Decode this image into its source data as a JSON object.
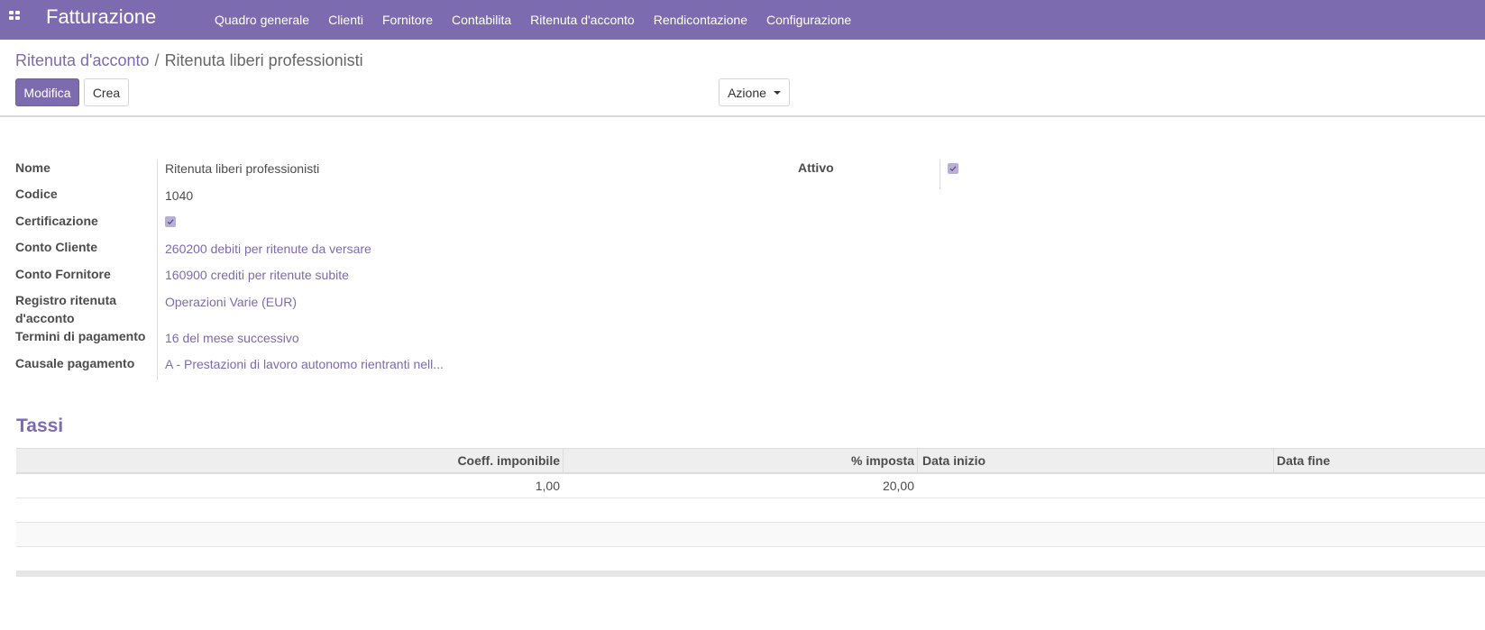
{
  "app": {
    "title": "Fatturazione"
  },
  "menu": [
    "Quadro generale",
    "Clienti",
    "Fornitore",
    "Contabilita",
    "Ritenuta d'acconto",
    "Rendicontazione",
    "Configurazione"
  ],
  "breadcrumb": {
    "parent": "Ritenuta d'acconto",
    "separator": "/",
    "current": "Ritenuta liberi professionisti"
  },
  "buttons": {
    "edit": "Modifica",
    "create": "Crea",
    "action": "Azione"
  },
  "form": {
    "nome": {
      "label": "Nome",
      "value": "Ritenuta liberi professionisti"
    },
    "codice": {
      "label": "Codice",
      "value": "1040"
    },
    "certificazione": {
      "label": "Certificazione",
      "checked": true
    },
    "conto_cliente": {
      "label": "Conto Cliente",
      "value": "260200 debiti per ritenute da versare"
    },
    "conto_fornitore": {
      "label": "Conto Fornitore",
      "value": "160900 crediti per ritenute subite"
    },
    "registro": {
      "label": "Registro ritenuta d'acconto",
      "value": "Operazioni Varie (EUR)"
    },
    "termini": {
      "label": "Termini di pagamento",
      "value": "16 del mese successivo"
    },
    "causale": {
      "label": "Causale pagamento",
      "value": "A - Prestazioni di lavoro autonomo rientranti nell..."
    },
    "attivo": {
      "label": "Attivo",
      "checked": true
    }
  },
  "tassi": {
    "title": "Tassi",
    "columns": [
      "Coeff. imponibile",
      "% imposta",
      "Data inizio",
      "Data fine"
    ],
    "rows": [
      {
        "coeff": "1,00",
        "imposta": "20,00",
        "data_inizio": "",
        "data_fine": ""
      }
    ]
  },
  "colors": {
    "primary": "#7c6bae",
    "navbar": "#7c6bae"
  }
}
